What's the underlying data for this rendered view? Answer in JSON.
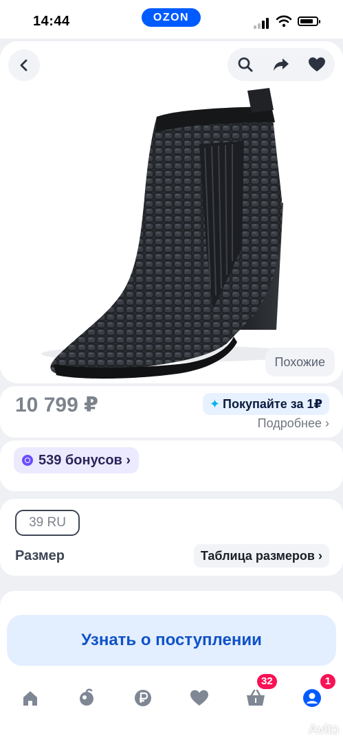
{
  "status_bar": {
    "time": "14:44",
    "app_badge": "OZON"
  },
  "product": {
    "similar_label": "Похожие",
    "price": "10 799 ₽",
    "promo_label": "Покупайте за 1₽",
    "more_label": "Подробнее ›",
    "bonus_label": "539 бонусов ›",
    "size_value": "39 RU",
    "size_label": "Размер",
    "size_table_label": "Таблица размеров ›",
    "notify_button": "Узнать о поступлении"
  },
  "bottom_nav": {
    "items": [
      "home-icon",
      "catalog-icon",
      "ozon-ruble-icon",
      "favorites-icon",
      "cart-icon",
      "profile-icon"
    ],
    "cart_badge": "32",
    "profile_badge": "1"
  },
  "watermark": "Avito",
  "colors": {
    "brand": "#005bff",
    "badge": "#f91155",
    "notify_button_bg": "#e3eeff",
    "notify_button_text": "#0f52c8"
  }
}
